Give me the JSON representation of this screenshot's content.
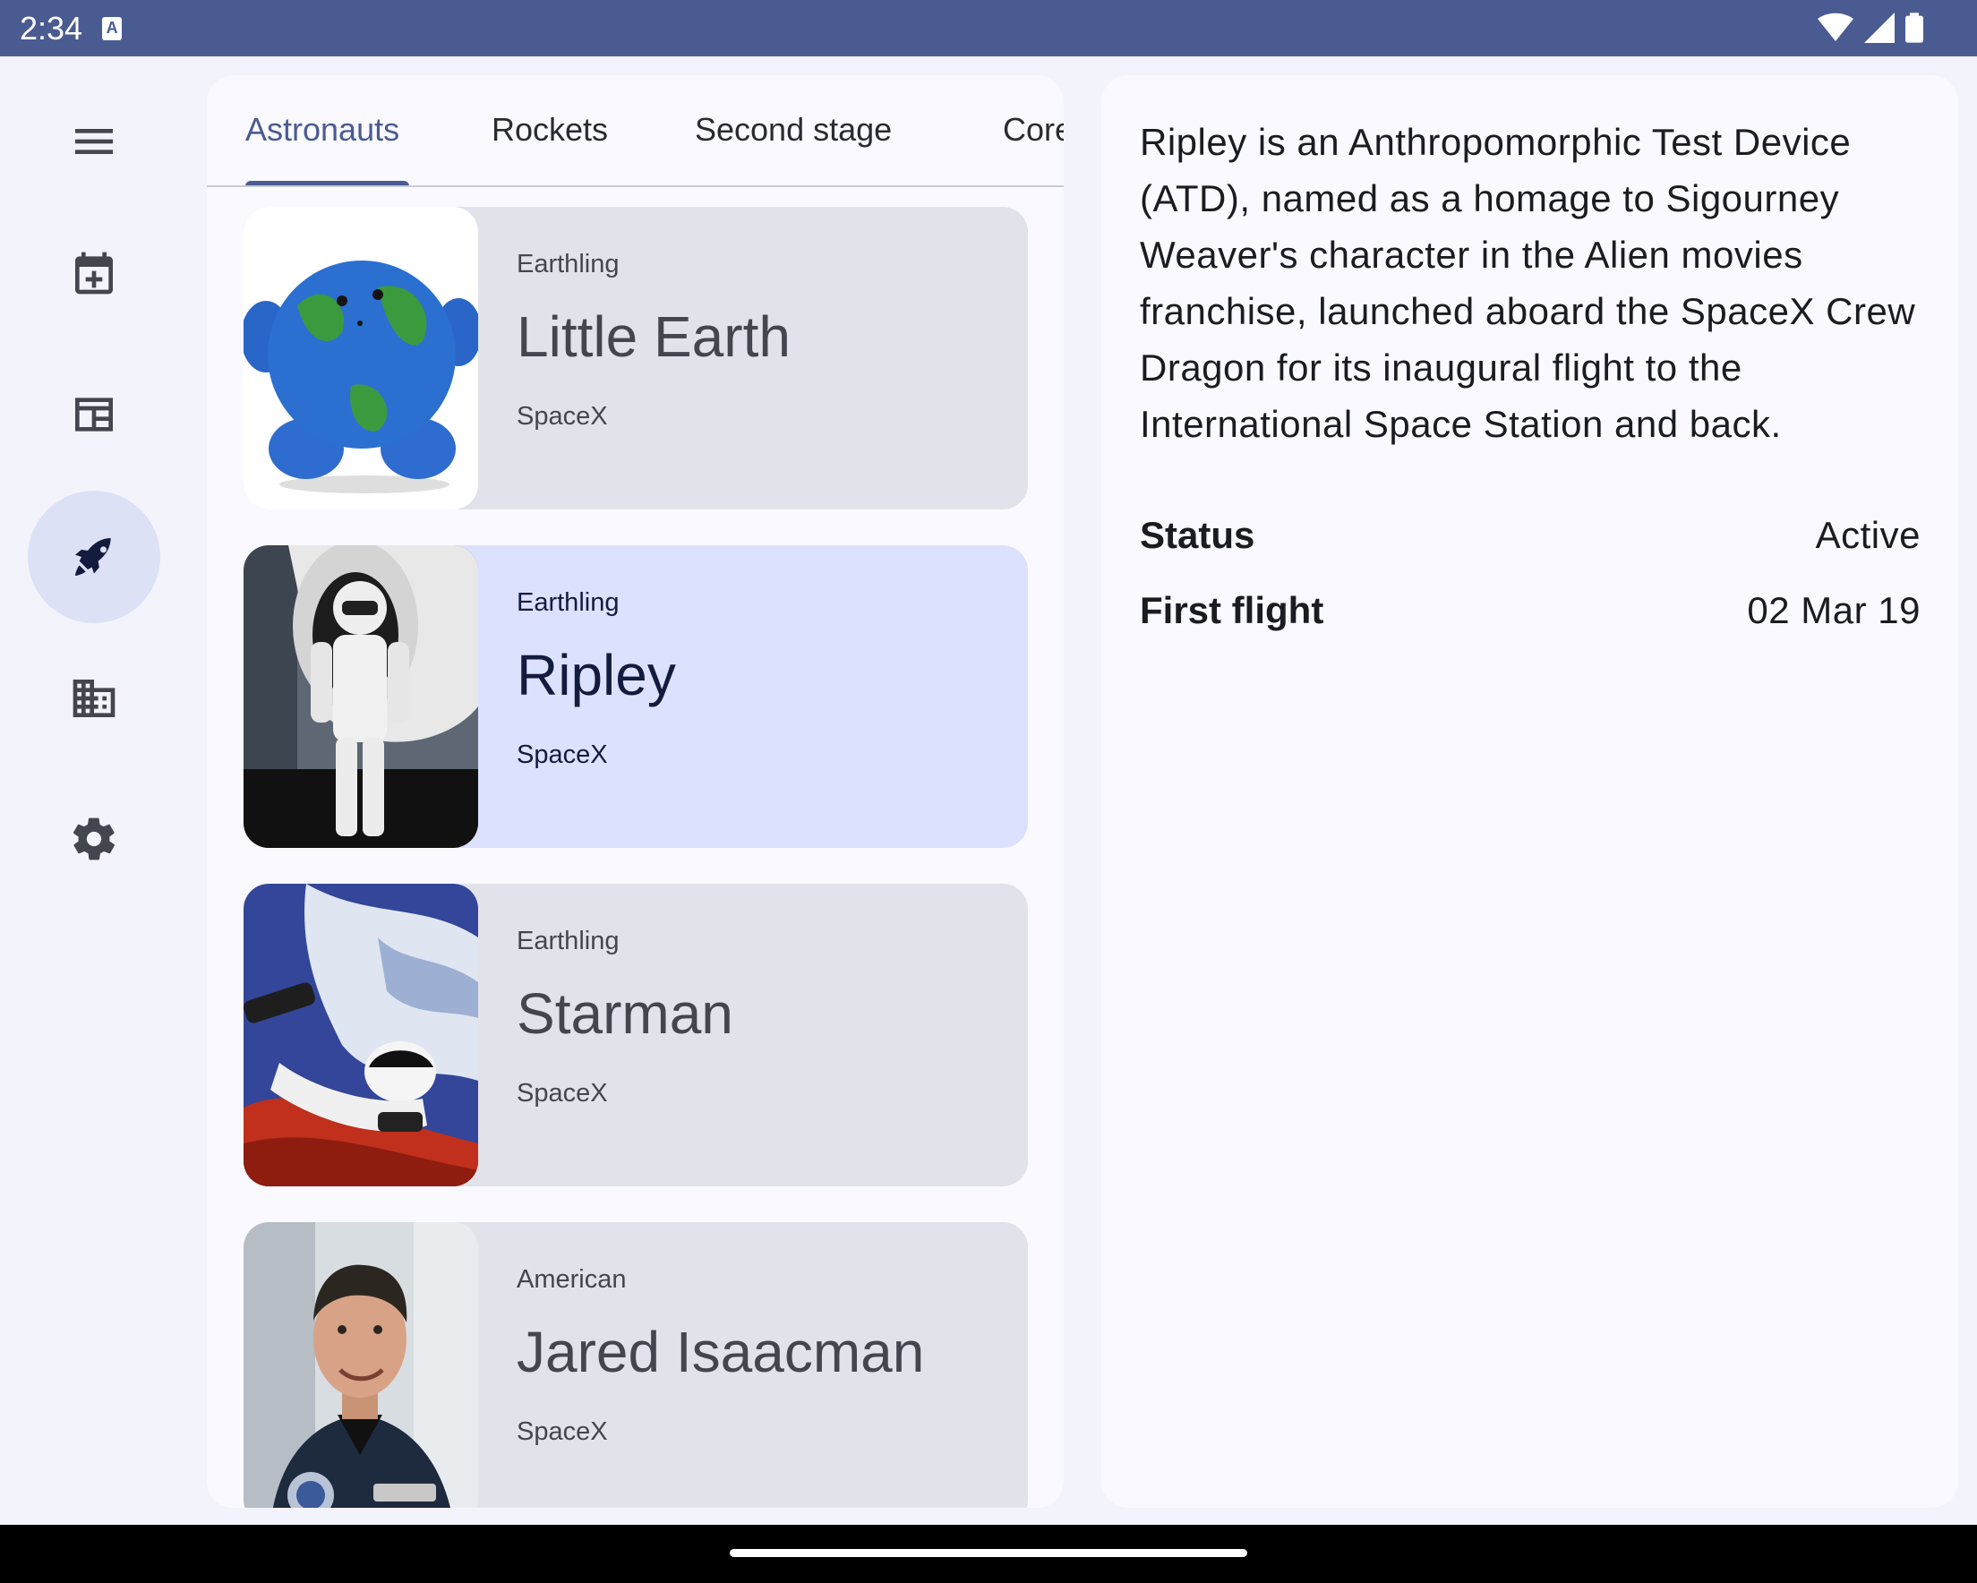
{
  "status_bar": {
    "time": "2:34",
    "notification_icon": "A"
  },
  "nav_rail": {
    "items": [
      {
        "icon": "menu-icon"
      },
      {
        "icon": "calendar-add-icon"
      },
      {
        "icon": "news-icon"
      },
      {
        "icon": "rocket-icon",
        "active": true
      },
      {
        "icon": "company-icon"
      },
      {
        "icon": "settings-icon"
      }
    ]
  },
  "tabs": [
    {
      "label": "Astronauts",
      "active": true
    },
    {
      "label": "Rockets"
    },
    {
      "label": "Second stage"
    },
    {
      "label": "Core"
    }
  ],
  "astronauts": [
    {
      "category": "Earthling",
      "name": "Little Earth",
      "org": "SpaceX"
    },
    {
      "category": "Earthling",
      "name": "Ripley",
      "org": "SpaceX",
      "selected": true
    },
    {
      "category": "Earthling",
      "name": "Starman",
      "org": "SpaceX"
    },
    {
      "category": "American",
      "name": "Jared Isaacman",
      "org": "SpaceX"
    }
  ],
  "detail": {
    "description": "Ripley is an Anthropomorphic Test Device (ATD), named as a homage to Sigourney Weaver's character in the Alien movies franchise, launched aboard the SpaceX Crew Dragon for its inaugural flight to the International Space Station and back.",
    "status_label": "Status",
    "status_value": "Active",
    "first_flight_label": "First flight",
    "first_flight_value": "02 Mar 19"
  },
  "colors": {
    "primary": "#4a5b91",
    "selected_card": "#dce1fd",
    "card": "#e2e2ea",
    "rail_active": "#dde1f6"
  }
}
